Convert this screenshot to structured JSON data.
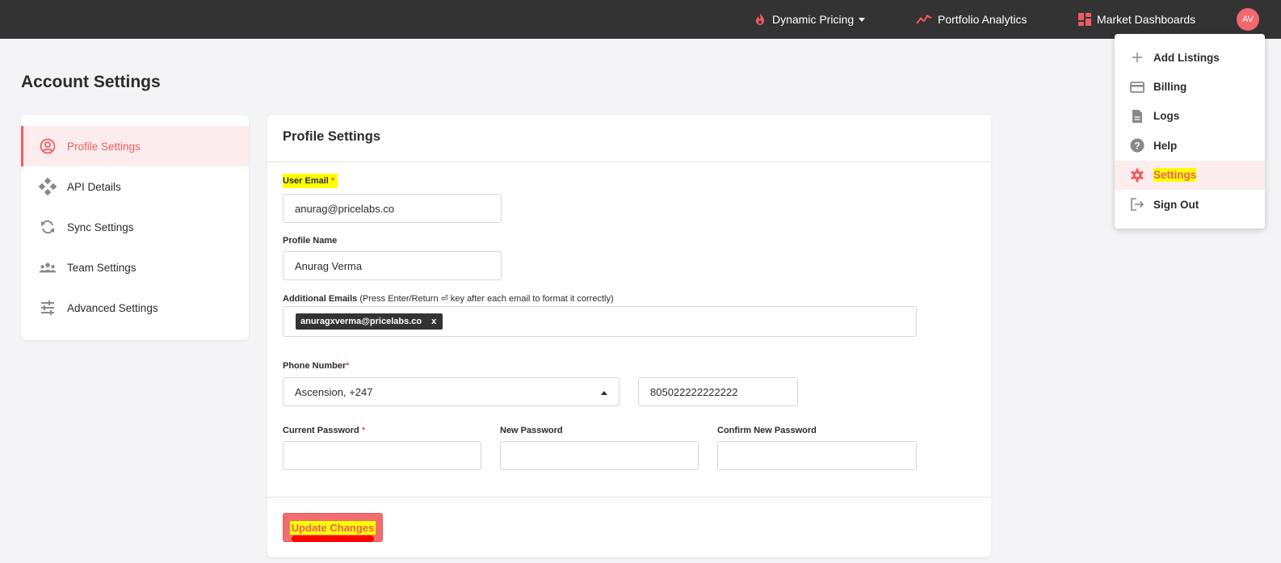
{
  "nav": {
    "dynamic_pricing": "Dynamic Pricing",
    "portfolio_analytics": "Portfolio Analytics",
    "market_dashboards": "Market Dashboards",
    "avatar_initials": "AV"
  },
  "page_title": "Account Settings",
  "sidebar": {
    "items": [
      {
        "label": "Profile Settings",
        "icon": "user-circle-icon",
        "active": true
      },
      {
        "label": "API Details",
        "icon": "api-icon"
      },
      {
        "label": "Sync Settings",
        "icon": "sync-icon"
      },
      {
        "label": "Team Settings",
        "icon": "team-icon"
      },
      {
        "label": "Advanced Settings",
        "icon": "sliders-icon"
      }
    ]
  },
  "profile": {
    "title": "Profile Settings",
    "user_email_label": "User Email",
    "user_email_value": "anurag@pricelabs.co",
    "profile_name_label": "Profile Name",
    "profile_name_value": "Anurag Verma",
    "additional_emails_label": "Additional Emails",
    "additional_emails_hint": "(Press Enter/Return ⏎ key after each email to format it correctly)",
    "additional_emails_tags": [
      "anuragxverma@pricelabs.co"
    ],
    "tag_remove": "x",
    "phone_label": "Phone Number",
    "country_value": "Ascension, +247",
    "phone_value": "805022222222222",
    "current_password_label": "Current Password",
    "new_password_label": "New Password",
    "confirm_password_label": "Confirm New Password",
    "required_mark": "*",
    "update_button": "Update Changes"
  },
  "dropdown": {
    "items": [
      {
        "label": "Add Listings",
        "icon": "plus-icon"
      },
      {
        "label": "Billing",
        "icon": "credit-card-icon"
      },
      {
        "label": "Logs",
        "icon": "document-icon"
      },
      {
        "label": "Help",
        "icon": "help-icon"
      },
      {
        "label": "Settings",
        "icon": "gear-icon",
        "active": true
      },
      {
        "label": "Sign Out",
        "icon": "sign-out-icon"
      }
    ]
  },
  "colors": {
    "accent": "#ee5c60",
    "nav_bg": "#333333",
    "highlight": "#ffff00"
  }
}
